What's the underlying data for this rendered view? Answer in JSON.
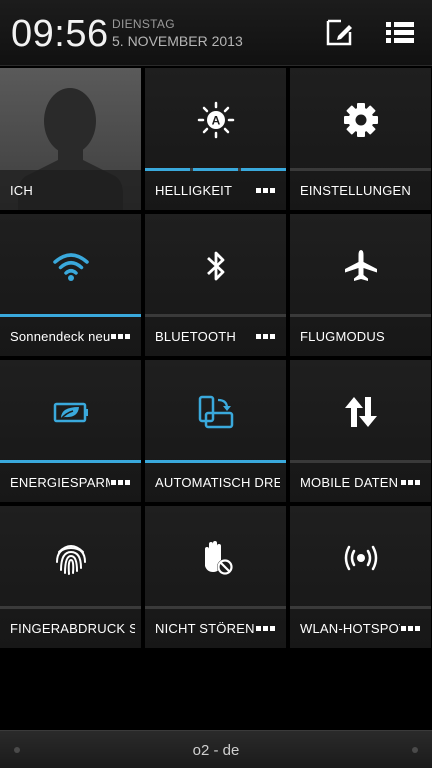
{
  "header": {
    "time": "09:56",
    "day": "DIENSTAG",
    "date": "5. NOVEMBER 2013"
  },
  "colors": {
    "accent": "#3aa9dc",
    "inactive_bar": "#3a3a3a",
    "tile_bg": "#1c1c1c"
  },
  "tiles": [
    {
      "label": "ICH",
      "icon": "person-silhouette-icon",
      "active": false,
      "has_more": false
    },
    {
      "label": "HELLIGKEIT",
      "icon": "brightness-auto-icon",
      "active": true,
      "has_more": true
    },
    {
      "label": "EINSTELLUNGEN",
      "icon": "gear-icon",
      "active": false,
      "has_more": false
    },
    {
      "label": "Sonnendeck neu",
      "icon": "wifi-icon",
      "active": true,
      "has_more": true
    },
    {
      "label": "BLUETOOTH",
      "icon": "bluetooth-icon",
      "active": false,
      "has_more": true
    },
    {
      "label": "FLUGMODUS",
      "icon": "airplane-icon",
      "active": false,
      "has_more": false
    },
    {
      "label": "ENERGIESPARMODUS",
      "icon": "battery-leaf-icon",
      "active": true,
      "has_more": true
    },
    {
      "label": "AUTOMATISCH DREHEN",
      "icon": "auto-rotate-icon",
      "active": true,
      "has_more": false
    },
    {
      "label": "MOBILE DATEN",
      "icon": "data-arrows-icon",
      "active": false,
      "has_more": true
    },
    {
      "label": "FINGERABDRUCK SCANNER",
      "icon": "fingerprint-icon",
      "active": false,
      "has_more": false
    },
    {
      "label": "NICHT STÖREN",
      "icon": "do-not-disturb-hand-icon",
      "active": false,
      "has_more": true
    },
    {
      "label": "WLAN-HOTSPOT",
      "icon": "hotspot-icon",
      "active": false,
      "has_more": true
    }
  ],
  "footer": {
    "carrier": "o2 - de"
  }
}
